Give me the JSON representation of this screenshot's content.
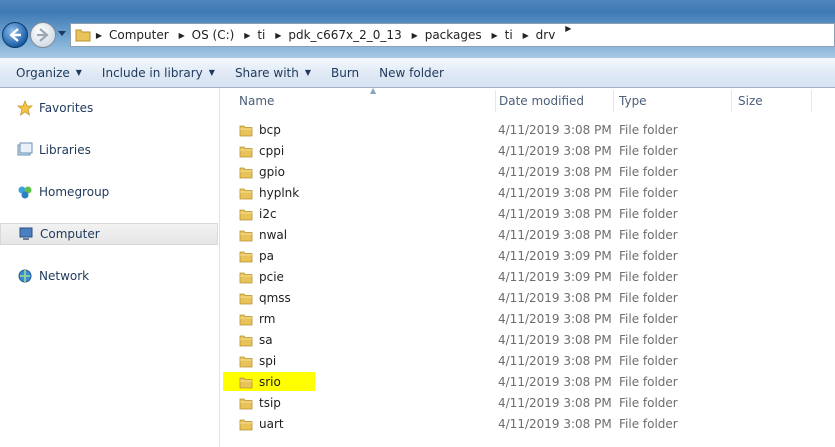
{
  "breadcrumbs": [
    "Computer",
    "OS (C:)",
    "ti",
    "pdk_c667x_2_0_13",
    "packages",
    "ti",
    "drv"
  ],
  "commands": [
    {
      "label": "Organize",
      "dropdown": true
    },
    {
      "label": "Include in library",
      "dropdown": true
    },
    {
      "label": "Share with",
      "dropdown": true
    },
    {
      "label": "Burn",
      "dropdown": false
    },
    {
      "label": "New folder",
      "dropdown": false
    }
  ],
  "nav": {
    "favorites": "Favorites",
    "libraries": "Libraries",
    "homegroup": "Homegroup",
    "computer": "Computer",
    "network": "Network"
  },
  "columns": {
    "name": "Name",
    "date": "Date modified",
    "type": "Type",
    "size": "Size"
  },
  "files": [
    {
      "name": "bcp",
      "date": "4/11/2019 3:08 PM",
      "type": "File folder"
    },
    {
      "name": "cppi",
      "date": "4/11/2019 3:08 PM",
      "type": "File folder"
    },
    {
      "name": "gpio",
      "date": "4/11/2019 3:08 PM",
      "type": "File folder"
    },
    {
      "name": "hyplnk",
      "date": "4/11/2019 3:08 PM",
      "type": "File folder"
    },
    {
      "name": "i2c",
      "date": "4/11/2019 3:08 PM",
      "type": "File folder"
    },
    {
      "name": "nwal",
      "date": "4/11/2019 3:08 PM",
      "type": "File folder"
    },
    {
      "name": "pa",
      "date": "4/11/2019 3:09 PM",
      "type": "File folder"
    },
    {
      "name": "pcie",
      "date": "4/11/2019 3:09 PM",
      "type": "File folder"
    },
    {
      "name": "qmss",
      "date": "4/11/2019 3:08 PM",
      "type": "File folder"
    },
    {
      "name": "rm",
      "date": "4/11/2019 3:08 PM",
      "type": "File folder"
    },
    {
      "name": "sa",
      "date": "4/11/2019 3:08 PM",
      "type": "File folder"
    },
    {
      "name": "spi",
      "date": "4/11/2019 3:08 PM",
      "type": "File folder"
    },
    {
      "name": "srio",
      "date": "4/11/2019 3:08 PM",
      "type": "File folder",
      "highlighted": true
    },
    {
      "name": "tsip",
      "date": "4/11/2019 3:08 PM",
      "type": "File folder"
    },
    {
      "name": "uart",
      "date": "4/11/2019 3:08 PM",
      "type": "File folder"
    }
  ],
  "colors": {
    "highlight": "#ffff00",
    "folder": "#e8c35a",
    "accent": "#1e395b"
  }
}
